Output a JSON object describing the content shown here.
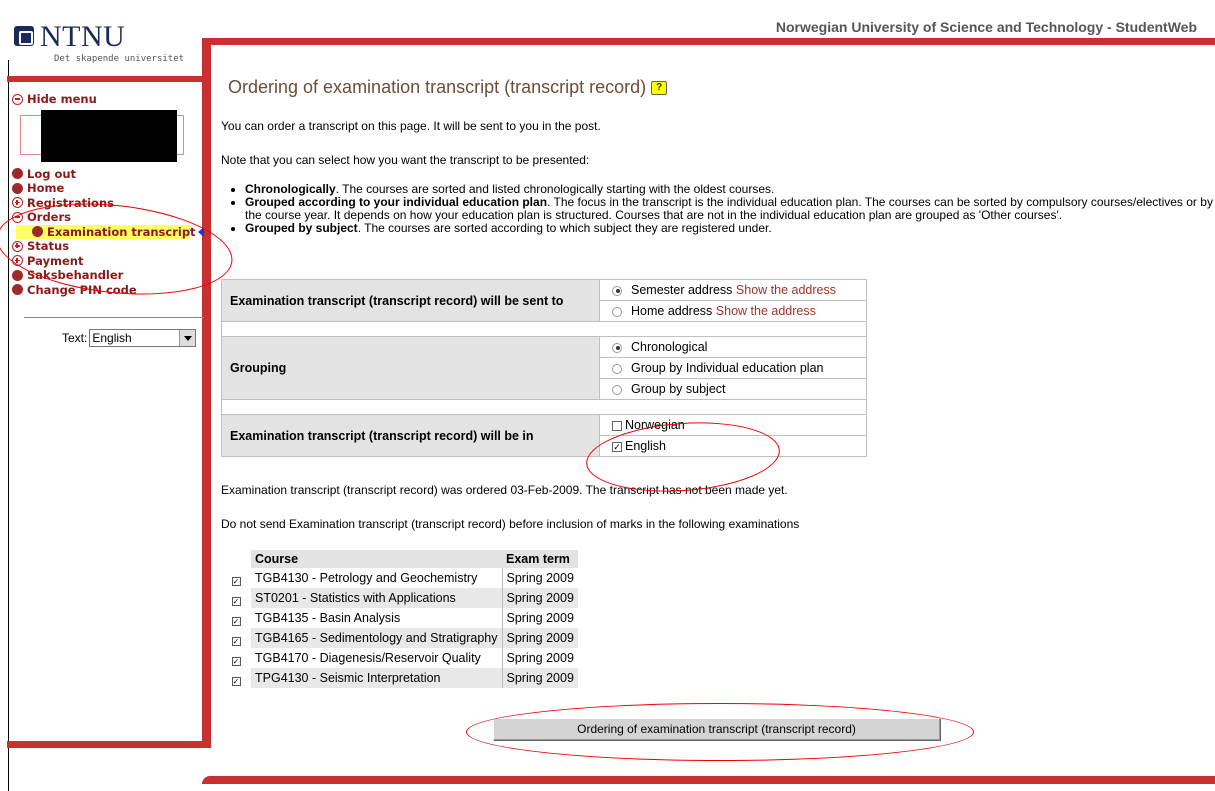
{
  "header": {
    "logo_text": "NTNU",
    "logo_tagline": "Det skapende universitet",
    "site_title": "Norwegian University of Science and Technology - StudentWeb"
  },
  "sidebar": {
    "hide_menu": "Hide menu",
    "items": [
      {
        "label": "Log out",
        "icon": "dot"
      },
      {
        "label": "Home",
        "icon": "dot"
      },
      {
        "label": "Registrations",
        "icon": "plus"
      },
      {
        "label": "Orders",
        "icon": "minus"
      },
      {
        "label": "Examination transcript",
        "icon": "dot",
        "active": true
      },
      {
        "label": "Status",
        "icon": "plus"
      },
      {
        "label": "Payment",
        "icon": "plus"
      },
      {
        "label": "Saksbehandler",
        "icon": "dot"
      },
      {
        "label": "Change PIN code",
        "icon": "dot"
      }
    ],
    "text_label": "Text:",
    "language_selected": "English"
  },
  "main": {
    "title": "Ordering of examination transcript (transcript record)",
    "intro1": "You can order a transcript on this page. It will be sent to you in the post.",
    "intro2": "Note that you can select how you want the transcript to be presented:",
    "bullets": [
      {
        "bold": "Chronologically",
        "text": ". The courses are sorted and listed chronologically starting with the oldest courses."
      },
      {
        "bold": "Grouped according to your individual education plan",
        "text": ". The focus in the transcript is the individual education plan. The courses can be sorted by compulsory courses/electives or by the course year. It depends on how your education plan is structured. Courses that are not in the individual education plan are grouped as 'Other courses'."
      },
      {
        "bold": "Grouped by subject",
        "text": ". The courses are sorted according to which subject they are registered under."
      }
    ],
    "sent_to": {
      "question": "Examination transcript (transcript record) will be sent to",
      "opt1": "Semester address",
      "opt1_link": "Show the address",
      "opt2": "Home address",
      "opt2_link": "Show the address"
    },
    "grouping": {
      "question": "Grouping",
      "opt1": "Chronological",
      "opt2": "Group by Individual education plan",
      "opt3": "Group by subject"
    },
    "language": {
      "question": "Examination transcript (transcript record) will be in",
      "opt1": "Norwegian",
      "opt2": "English"
    },
    "ordered_msg": "Examination transcript (transcript record) was ordered 03-Feb-2009. The transcript has not been made yet.",
    "donot_msg": "Do not send Examination transcript (transcript record) before inclusion of marks in the following examinations",
    "courses_header": {
      "course": "Course",
      "term": "Exam term"
    },
    "courses": [
      {
        "course": "TGB4130 - Petrology and Geochemistry",
        "term": "Spring 2009"
      },
      {
        "course": "ST0201 - Statistics with Applications",
        "term": "Spring 2009"
      },
      {
        "course": "TGB4135 - Basin Analysis",
        "term": "Spring 2009"
      },
      {
        "course": "TGB4165 - Sedimentology and Stratigraphy",
        "term": "Spring 2009"
      },
      {
        "course": "TGB4170 - Diagenesis/Reservoir Quality",
        "term": "Spring 2009"
      },
      {
        "course": "TPG4130 - Seismic Interpretation",
        "term": "Spring 2009"
      }
    ],
    "order_button": "Ordering of examination transcript (transcript record)"
  },
  "colors": {
    "frame_red": "#c8312f",
    "link_red": "#8b1a1a",
    "title_brown": "#6b4e3a",
    "highlight_yellow": "#ffff66",
    "annotation_red": "#e00000"
  }
}
